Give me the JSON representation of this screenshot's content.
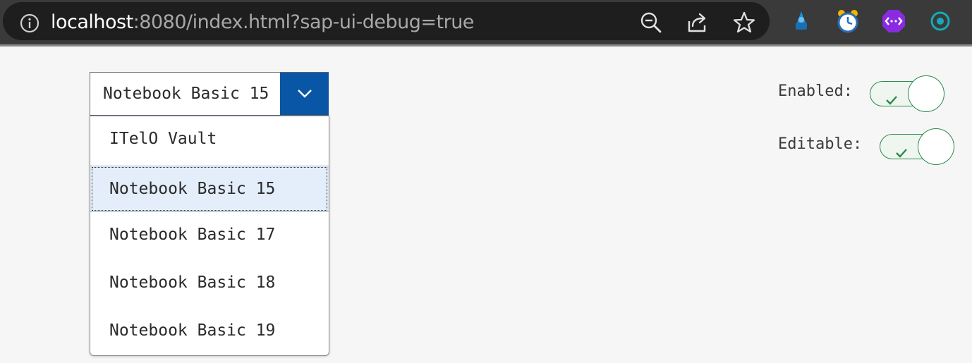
{
  "browser": {
    "url_host": "localhost",
    "url_rest": ":8080/index.html?sap-ui-debug=true",
    "icons": [
      "info-icon",
      "zoom-out-icon",
      "share-icon",
      "favorite-star-icon"
    ],
    "extensions": [
      "extension-wizard-icon",
      "extension-alarm-clock-icon",
      "extension-purple-icon",
      "extension-teal-icon"
    ]
  },
  "product_select": {
    "value": "Notebook Basic 15",
    "options": [
      "ITelO Vault",
      "Notebook Basic 15",
      "Notebook Basic 17",
      "Notebook Basic 18",
      "Notebook Basic 19"
    ],
    "selected_index": 1
  },
  "toggles": {
    "enabled": {
      "label": "Enabled:",
      "on": true
    },
    "editable": {
      "label": "Editable:",
      "on": true
    }
  },
  "colors": {
    "accent": "#0a56a6",
    "switch_on": "#2a8a4a",
    "selected_item_bg": "#e4eefa"
  }
}
